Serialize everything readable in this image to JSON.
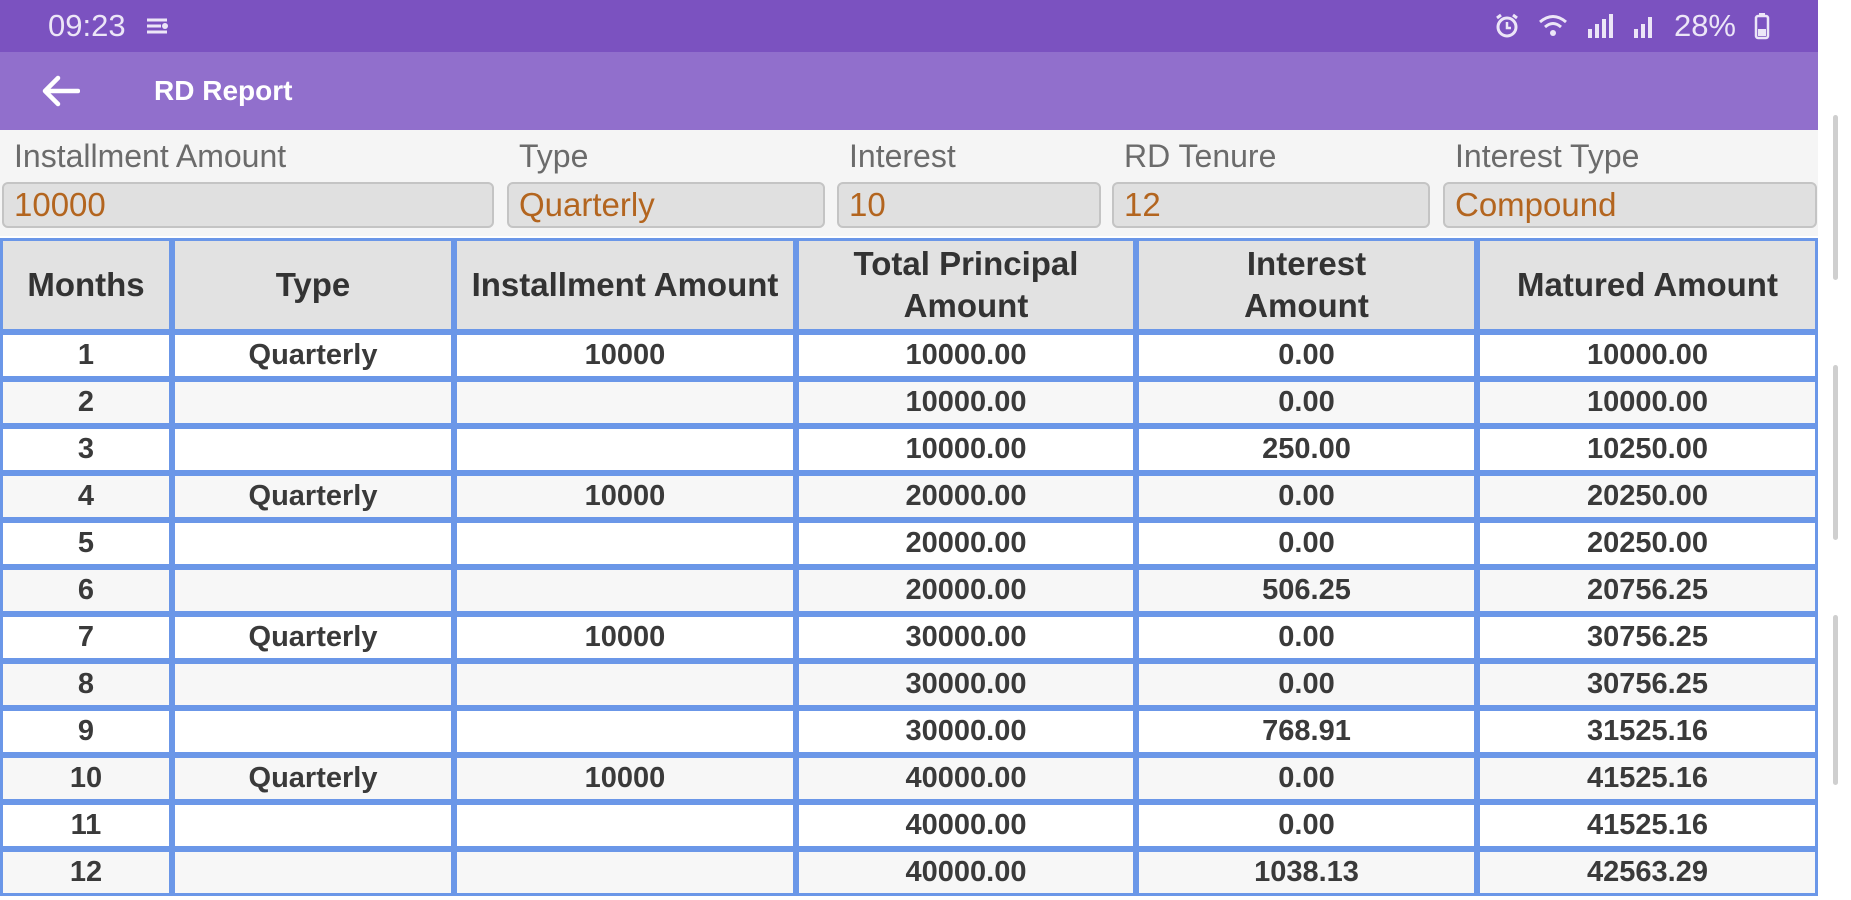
{
  "status_bar": {
    "time": "09:23",
    "battery_text": "28%",
    "icons": [
      "notification-icon",
      "alarm-icon",
      "wifi-icon",
      "signal-icon",
      "signal-icon",
      "battery-icon"
    ]
  },
  "app_bar": {
    "title": "RD Report",
    "back_icon": "back-arrow-icon",
    "background": "#916fcc",
    "status_background": "#7b52c0"
  },
  "form": {
    "installment_amount": {
      "label": "Installment Amount",
      "value": "10000"
    },
    "type": {
      "label": "Type",
      "value": "Quarterly"
    },
    "interest": {
      "label": "Interest",
      "value": "10"
    },
    "rd_tenure": {
      "label": "RD Tenure",
      "value": "12"
    },
    "interest_type": {
      "label": "Interest Type",
      "value": "Compound"
    }
  },
  "table": {
    "headers": [
      "Months",
      "Type",
      "Installment Amount",
      "Total Principal\nAmount",
      "Interest\nAmount",
      "Matured Amount"
    ],
    "rows": [
      [
        "1",
        "Quarterly",
        "10000",
        "10000.00",
        "0.00",
        "10000.00"
      ],
      [
        "2",
        "",
        "",
        "10000.00",
        "0.00",
        "10000.00"
      ],
      [
        "3",
        "",
        "",
        "10000.00",
        "250.00",
        "10250.00"
      ],
      [
        "4",
        "Quarterly",
        "10000",
        "20000.00",
        "0.00",
        "20250.00"
      ],
      [
        "5",
        "",
        "",
        "20000.00",
        "0.00",
        "20250.00"
      ],
      [
        "6",
        "",
        "",
        "20000.00",
        "506.25",
        "20756.25"
      ],
      [
        "7",
        "Quarterly",
        "10000",
        "30000.00",
        "0.00",
        "30756.25"
      ],
      [
        "8",
        "",
        "",
        "30000.00",
        "0.00",
        "30756.25"
      ],
      [
        "9",
        "",
        "",
        "30000.00",
        "768.91",
        "31525.16"
      ],
      [
        "10",
        "Quarterly",
        "10000",
        "40000.00",
        "0.00",
        "41525.16"
      ],
      [
        "11",
        "",
        "",
        "40000.00",
        "0.00",
        "41525.16"
      ],
      [
        "12",
        "",
        "",
        "40000.00",
        "1038.13",
        "42563.29"
      ]
    ],
    "border_color": "#6b97e8"
  }
}
